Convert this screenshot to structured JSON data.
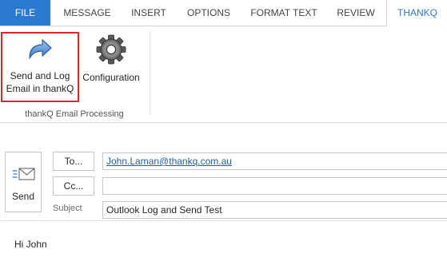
{
  "tabs": [
    {
      "label": "FILE"
    },
    {
      "label": "MESSAGE"
    },
    {
      "label": "INSERT"
    },
    {
      "label": "OPTIONS"
    },
    {
      "label": "FORMAT TEXT"
    },
    {
      "label": "REVIEW"
    },
    {
      "label": "THANKQ"
    }
  ],
  "ribbon": {
    "send_log_line1": "Send and Log",
    "send_log_line2": "Email in thankQ",
    "configuration_label": "Configuration",
    "group_label": "thankQ Email Processing"
  },
  "compose": {
    "send_label": "Send",
    "to_button": "To...",
    "cc_button": "Cc...",
    "to_value": "John.Laman@thankq.com.au",
    "cc_value": "",
    "subject_label": "Subject",
    "subject_value": "Outlook Log and Send Test",
    "body_text": "Hi John"
  },
  "colors": {
    "file_tab": "#2b79d0",
    "active_tab_text": "#2b79d0",
    "highlight_border": "#e0232d",
    "link": "#1f5fa8"
  },
  "icons": [
    "send-and-log-arrow-icon",
    "gear-icon",
    "send-envelope-icon"
  ]
}
